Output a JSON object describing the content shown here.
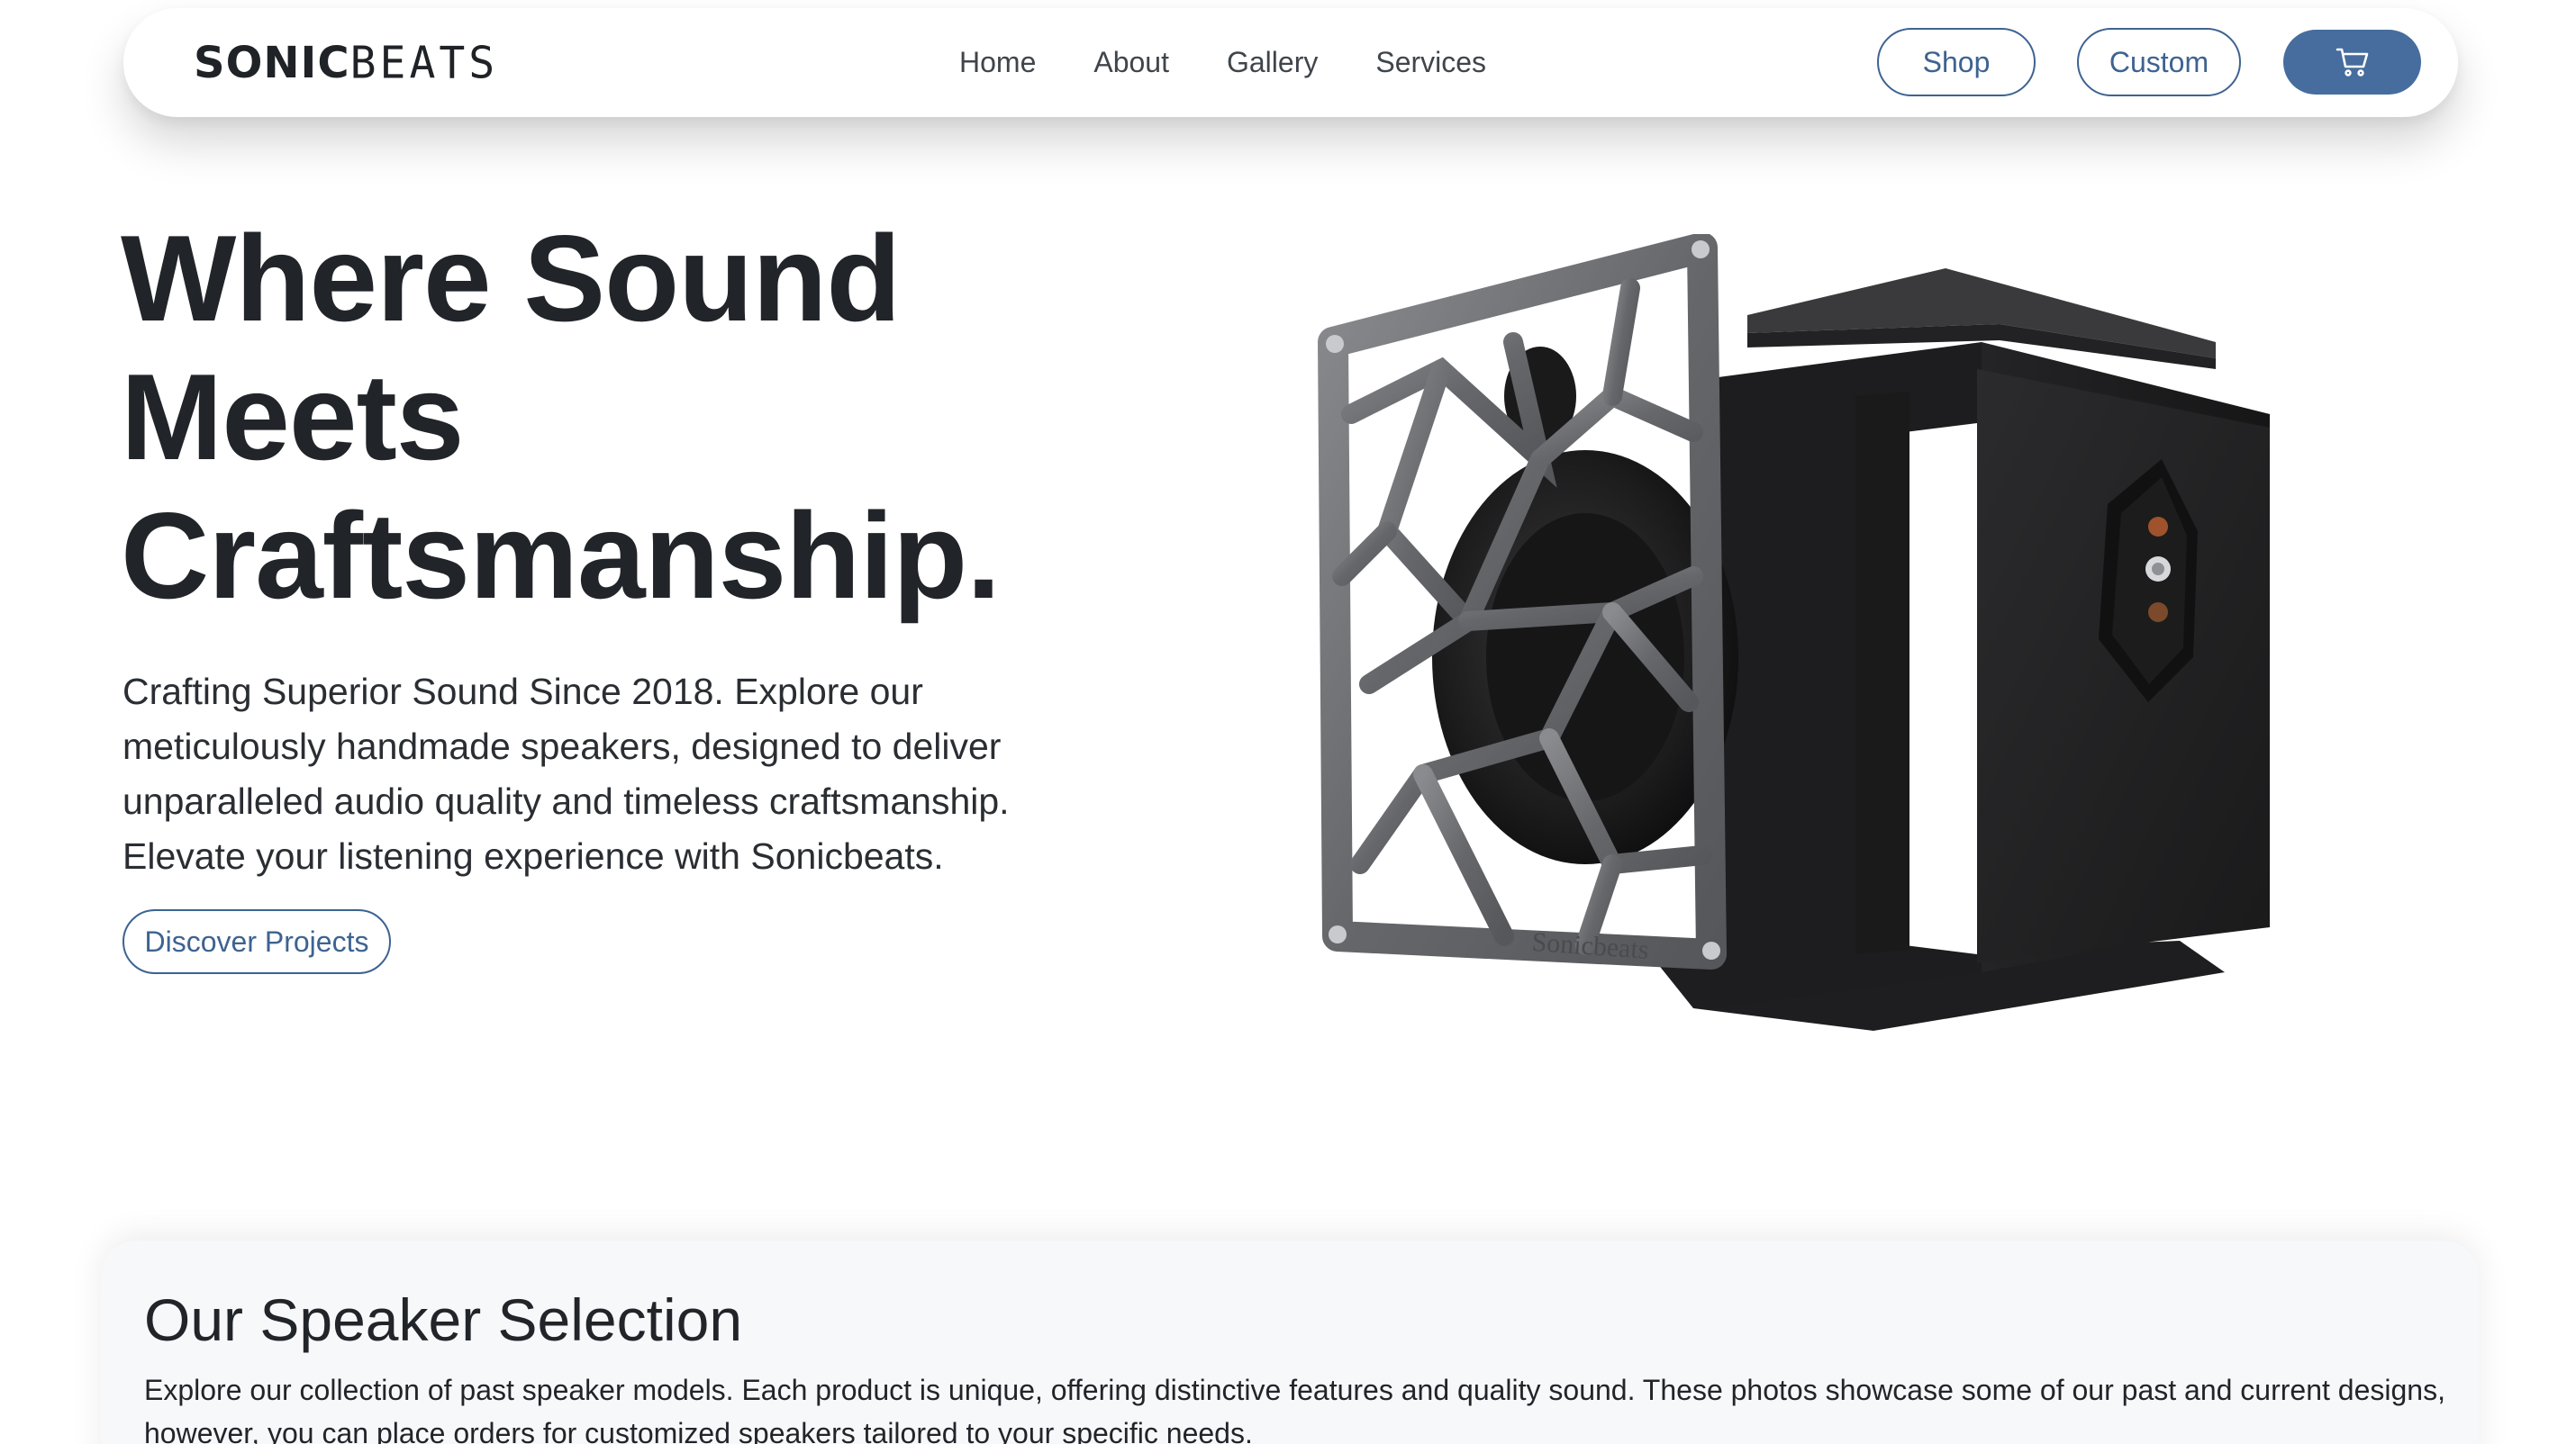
{
  "navbar": {
    "brand_bold": "SONIC",
    "brand_thin": "BEATS",
    "links": [
      "Home",
      "About",
      "Gallery",
      "Services"
    ],
    "shop_label": "Shop",
    "custom_label": "Custom",
    "cart_icon": "cart-icon"
  },
  "hero": {
    "title_lines": [
      "Where Sound",
      "Meets",
      "Craftsmanship."
    ],
    "description": "Crafting Superior Sound Since 2018. Explore our meticulously handmade speakers, designed to deliver unparalleled audio quality and timeless craftsmanship. Elevate your listening experience with Sonicbeats.",
    "cta_label": "Discover Projects",
    "image_icon": "speaker-product-image",
    "speaker_engraving": "Sonicbeats"
  },
  "selection": {
    "title": "Our Speaker Selection",
    "description": "Explore our collection of past speaker models. Each product is unique, offering distinctive features and quality sound. These photos showcase some of our past and current designs, however, you can place orders for customized speakers tailored to your specific needs."
  },
  "colors": {
    "accent": "#3d6391",
    "cart_button": "#466d9d",
    "text": "#212529",
    "section_bg": "#f7f8fa"
  }
}
